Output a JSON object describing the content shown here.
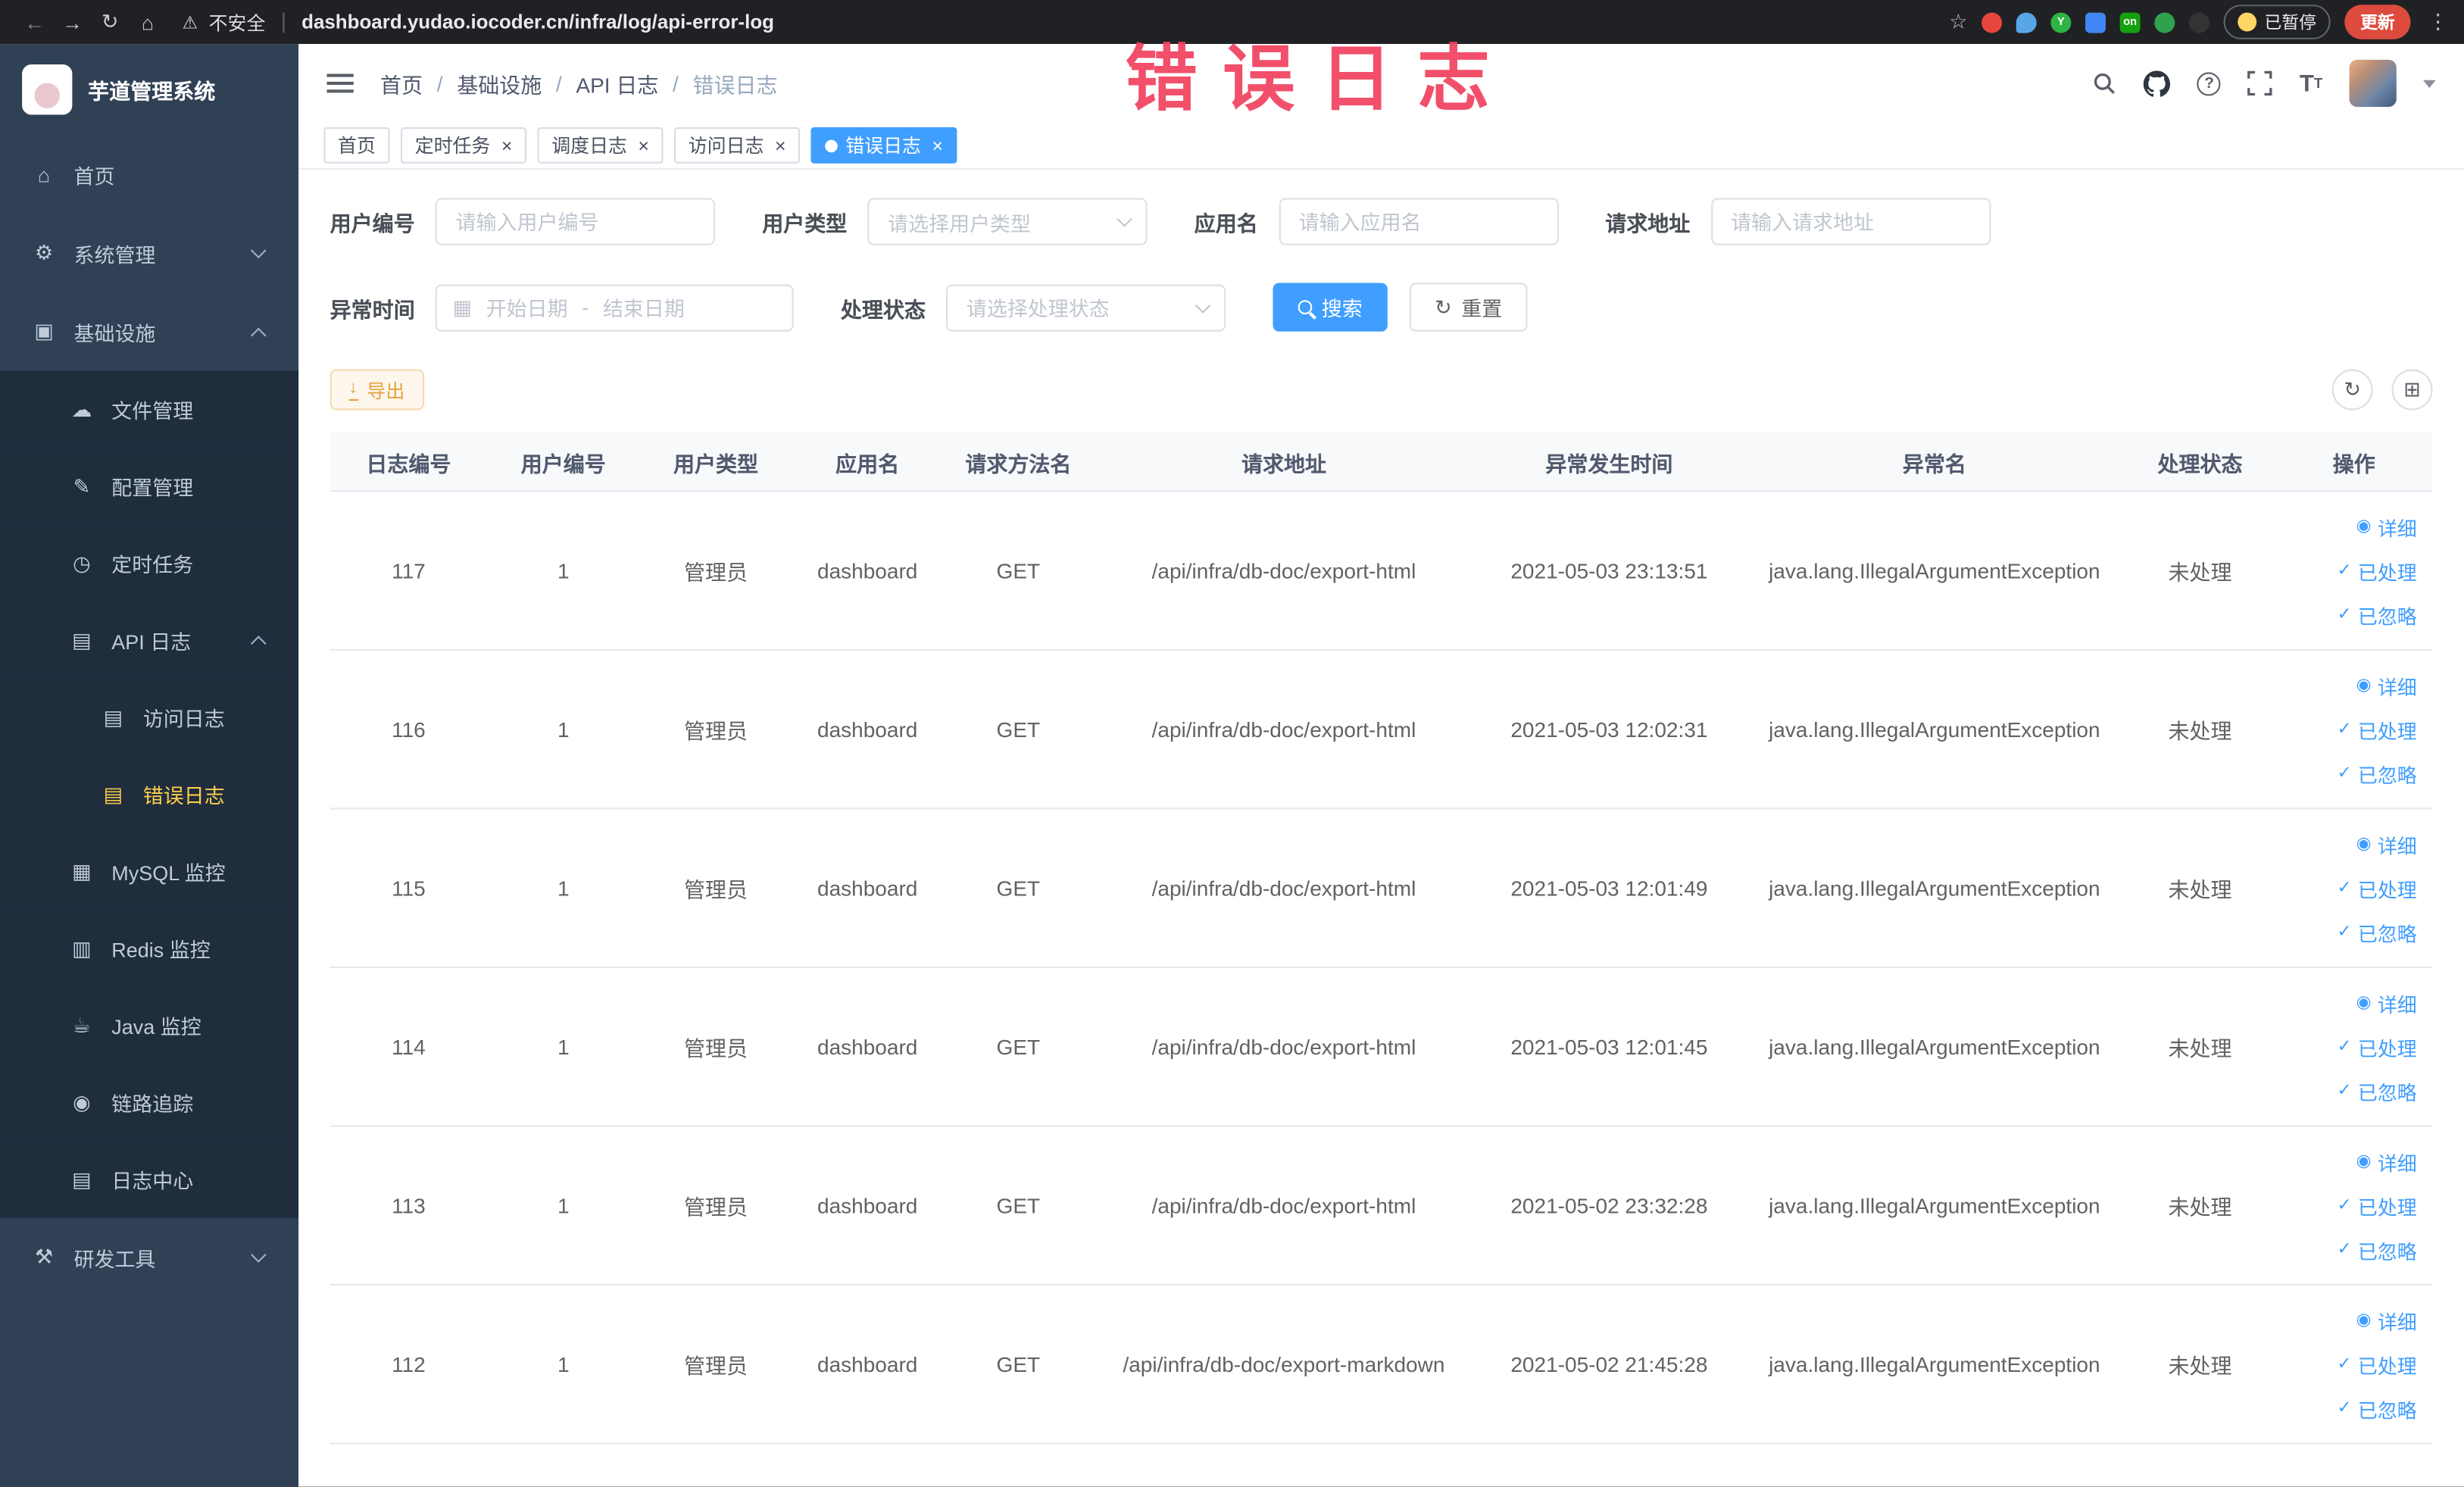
{
  "colors": {
    "accent_blue": "#409eff",
    "active_menu_yellow": "#ffd04b",
    "sidebar_bg": "#304156",
    "submenu_bg": "#1f2d3d",
    "annotation_red": "#f1425f",
    "export_orange": "#e6a23c",
    "update_button_red": "#dd4b3e"
  },
  "annotation": {
    "text": "错误日志"
  },
  "browser": {
    "security_label": "不安全",
    "url": "dashboard.yudao.iocoder.cn/infra/log/api-error-log",
    "paused_badge": "已暂停",
    "update_button": "更新",
    "extensions": [
      {
        "name": "extension-red-circle-icon",
        "color": "#e8453c",
        "shape": "circle",
        "label": ""
      },
      {
        "name": "extension-blue-drop-icon",
        "color": "#58a6e8",
        "shape": "drop",
        "label": ""
      },
      {
        "name": "extension-green-circle-icon",
        "color": "#2fb344",
        "shape": "circle",
        "label": "Y"
      },
      {
        "name": "extension-blue-grid-icon",
        "color": "#4285f4",
        "shape": "square",
        "label": ""
      },
      {
        "name": "extension-on-badge-icon",
        "color": "#13a10e",
        "shape": "square",
        "label": "on"
      },
      {
        "name": "extension-green-leaf-icon",
        "color": "#30a14e",
        "shape": "circle",
        "label": ""
      },
      {
        "name": "extension-dark-paw-icon",
        "color": "#333333",
        "shape": "circle",
        "label": ""
      }
    ]
  },
  "sidebar": {
    "title": "芋道管理系统",
    "items": [
      {
        "label": "首页",
        "level": 1,
        "icon": "home-icon",
        "glyph": "⌂"
      },
      {
        "label": "系统管理",
        "level": 1,
        "icon": "gear-icon",
        "glyph": "⚙",
        "chevron": "down"
      },
      {
        "label": "基础设施",
        "level": 1,
        "icon": "monitor-icon",
        "glyph": "▣",
        "chevron": "up"
      },
      {
        "label": "文件管理",
        "level": 2,
        "icon": "cloud-icon",
        "glyph": "☁"
      },
      {
        "label": "配置管理",
        "level": 2,
        "icon": "edit-icon",
        "glyph": "✎"
      },
      {
        "label": "定时任务",
        "level": 2,
        "icon": "clock-icon",
        "glyph": "◷"
      },
      {
        "label": "API 日志",
        "level": 2,
        "icon": "document-icon",
        "glyph": "▤",
        "chevron": "up"
      },
      {
        "label": "访问日志",
        "level": 3,
        "icon": "log-icon",
        "glyph": "▤"
      },
      {
        "label": "错误日志",
        "level": 3,
        "icon": "log-icon",
        "glyph": "▤",
        "active": true
      },
      {
        "label": "MySQL 监控",
        "level": 2,
        "icon": "database-icon",
        "glyph": "▦"
      },
      {
        "label": "Redis 监控",
        "level": 2,
        "icon": "database-icon",
        "glyph": "▥"
      },
      {
        "label": "Java 监控",
        "level": 2,
        "icon": "java-icon",
        "glyph": "☕"
      },
      {
        "label": "链路追踪",
        "level": 2,
        "icon": "trace-icon",
        "glyph": "◉"
      },
      {
        "label": "日志中心",
        "level": 2,
        "icon": "log-center-icon",
        "glyph": "▤"
      },
      {
        "label": "研发工具",
        "level": 1,
        "icon": "tools-icon",
        "glyph": "⚒",
        "chevron": "down"
      }
    ]
  },
  "header": {
    "breadcrumb": [
      {
        "label": "首页"
      },
      {
        "label": "基础设施"
      },
      {
        "label": "API 日志"
      },
      {
        "label": "错误日志",
        "current": true
      }
    ]
  },
  "tabs": [
    {
      "label": "首页",
      "closable": false,
      "active": false
    },
    {
      "label": "定时任务",
      "closable": true,
      "active": false
    },
    {
      "label": "调度日志",
      "closable": true,
      "active": false
    },
    {
      "label": "访问日志",
      "closable": true,
      "active": false
    },
    {
      "label": "错误日志",
      "closable": true,
      "active": true
    }
  ],
  "filters": {
    "user_id_label": "用户编号",
    "user_id_placeholder": "请输入用户编号",
    "user_type_label": "用户类型",
    "user_type_placeholder": "请选择用户类型",
    "app_name_label": "应用名",
    "app_name_placeholder": "请输入应用名",
    "request_url_label": "请求地址",
    "request_url_placeholder": "请输入请求地址",
    "exception_time_label": "异常时间",
    "start_date_placeholder": "开始日期",
    "range_separator": "-",
    "end_date_placeholder": "结束日期",
    "process_status_label": "处理状态",
    "process_status_placeholder": "请选择处理状态",
    "search_button": "搜索",
    "reset_button": "重置"
  },
  "toolbar": {
    "export_label": "导出"
  },
  "table": {
    "columns": [
      "日志编号",
      "用户编号",
      "用户类型",
      "应用名",
      "请求方法名",
      "请求地址",
      "异常发生时间",
      "异常名",
      "处理状态",
      "操作"
    ],
    "actions": [
      {
        "label": "详细",
        "name": "detail-link",
        "icon": "eye-icon",
        "glyph": "◉"
      },
      {
        "label": "已处理",
        "name": "mark-processed-link",
        "icon": "check-icon",
        "glyph": "✓"
      },
      {
        "label": "已忽略",
        "name": "mark-ignored-link",
        "icon": "check-icon",
        "glyph": "✓"
      }
    ],
    "rows": [
      {
        "id": "117",
        "user_id": "1",
        "user_type": "管理员",
        "app": "dashboard",
        "method": "GET",
        "url": "/api/infra/db-doc/export-html",
        "time": "2021-05-03 23:13:51",
        "exception": "java.lang.IllegalArgumentException",
        "status": "未处理"
      },
      {
        "id": "116",
        "user_id": "1",
        "user_type": "管理员",
        "app": "dashboard",
        "method": "GET",
        "url": "/api/infra/db-doc/export-html",
        "time": "2021-05-03 12:02:31",
        "exception": "java.lang.IllegalArgumentException",
        "status": "未处理"
      },
      {
        "id": "115",
        "user_id": "1",
        "user_type": "管理员",
        "app": "dashboard",
        "method": "GET",
        "url": "/api/infra/db-doc/export-html",
        "time": "2021-05-03 12:01:49",
        "exception": "java.lang.IllegalArgumentException",
        "status": "未处理"
      },
      {
        "id": "114",
        "user_id": "1",
        "user_type": "管理员",
        "app": "dashboard",
        "method": "GET",
        "url": "/api/infra/db-doc/export-html",
        "time": "2021-05-03 12:01:45",
        "exception": "java.lang.IllegalArgumentException",
        "status": "未处理"
      },
      {
        "id": "113",
        "user_id": "1",
        "user_type": "管理员",
        "app": "dashboard",
        "method": "GET",
        "url": "/api/infra/db-doc/export-html",
        "time": "2021-05-02 23:32:28",
        "exception": "java.lang.IllegalArgumentException",
        "status": "未处理"
      },
      {
        "id": "112",
        "user_id": "1",
        "user_type": "管理员",
        "app": "dashboard",
        "method": "GET",
        "url": "/api/infra/db-doc/export-markdown",
        "time": "2021-05-02 21:45:28",
        "exception": "java.lang.IllegalArgumentException",
        "status": "未处理"
      }
    ]
  }
}
